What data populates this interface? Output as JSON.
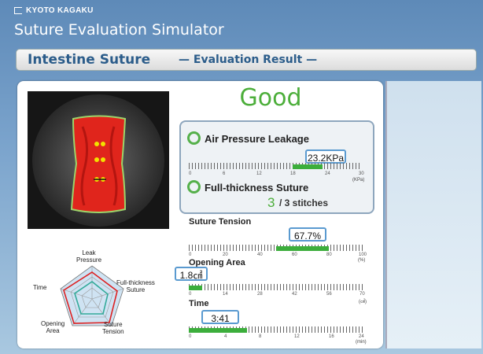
{
  "brand": "KYOTO KAGAKU",
  "app_title": "Suture Evaluation Simulator",
  "header": {
    "main": "Intestine Suture",
    "sub": "— Evaluation Result —"
  },
  "grade": "Good",
  "air_pressure": {
    "label": "Air Pressure Leakage",
    "value": "23.2KPa",
    "fraction": 0.773,
    "ticks": [
      "0",
      "6",
      "12",
      "18",
      "24",
      "30"
    ],
    "unit": "(KPa)"
  },
  "full_thickness": {
    "label": "Full-thickness Suture",
    "count": "3",
    "total": "/ 3 stitches"
  },
  "suture_tension": {
    "label": "Suture Tension",
    "value": "67.7%",
    "fill_start": 0.5,
    "fill_end": 0.8,
    "ticks": [
      "0",
      "20",
      "40",
      "60",
      "80",
      "100"
    ],
    "unit": "(%)"
  },
  "opening_area": {
    "label": "Opening Area",
    "value": "1.8㎠",
    "fraction": 0.026,
    "ticks": [
      "0",
      "14",
      "28",
      "42",
      "56",
      "70"
    ],
    "unit": "(㎠)"
  },
  "time": {
    "label": "Time",
    "value": "3:41",
    "fraction": 0.333,
    "ticks": [
      "0",
      "4",
      "8",
      "12",
      "16",
      "24"
    ],
    "unit": "(min)"
  },
  "radar": {
    "labels": {
      "top": "Leak\nPressure",
      "right": "Full-thickness\nSuture",
      "bottom_right": "Suture\nTension",
      "bottom_left": "Opening\nArea",
      "left": "Time"
    }
  },
  "colors": {
    "good": "#4cae3a",
    "fill": "#3cae3c",
    "accent": "#2b5c8a"
  }
}
